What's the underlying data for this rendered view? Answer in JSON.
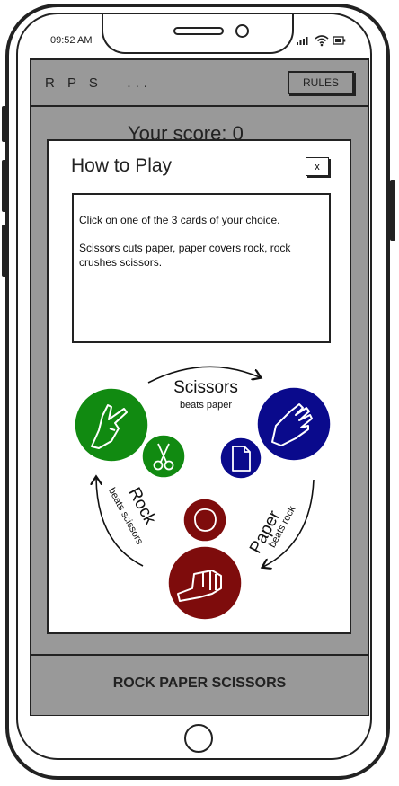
{
  "status_bar": {
    "time": "09:52 AM"
  },
  "header": {
    "title": "R P S   ...",
    "rules_label": "RULES"
  },
  "score": {
    "text": "Your score: 0"
  },
  "modal": {
    "title": "How to Play",
    "close_label": "x",
    "paragraph1": "Click on one of the 3 cards of your choice.",
    "paragraph2": "Scissors cuts paper, paper covers rock, rock crushes scissors."
  },
  "diagram": {
    "scissors": {
      "name": "Scissors",
      "beats": "beats paper",
      "color": "#118a11"
    },
    "paper": {
      "name": "Paper",
      "beats": "beats rock",
      "color": "#0a0a8c"
    },
    "rock": {
      "name": "Rock",
      "beats": "beats scissors",
      "color": "#7e0c0c"
    }
  },
  "footer": {
    "label": "ROCK PAPER SCISSORS"
  }
}
